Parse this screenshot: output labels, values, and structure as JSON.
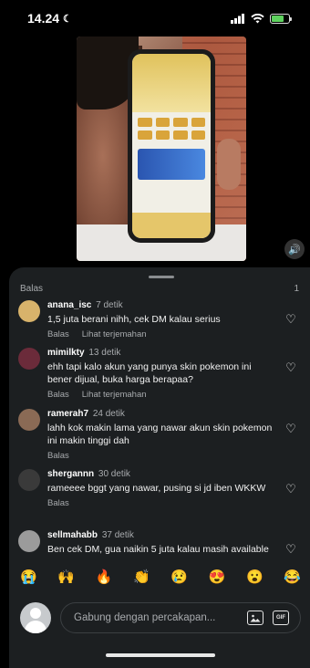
{
  "status": {
    "time": "14.24",
    "moon_icon": "moon-icon"
  },
  "video": {
    "volume_icon": "speaker-icon"
  },
  "sheet": {
    "top_reply_label": "Balas",
    "count": "1"
  },
  "comments": [
    {
      "user": "anana_isc",
      "time": "7 detik",
      "text": "1,5 juta berani nihh, cek DM kalau serius",
      "reply": "Balas",
      "translate": "Lihat terjemahan",
      "avatar_color": "#d8b36b"
    },
    {
      "user": "mimilkty",
      "time": "13 detik",
      "text": "ehh tapi kalo akun yang punya skin pokemon ini bener dijual, buka harga berapaa?",
      "reply": "Balas",
      "translate": "Lihat terjemahan",
      "avatar_color": "#6b2b3a"
    },
    {
      "user": "ramerah7",
      "time": "24 detik",
      "text": "lahh kok makin lama yang nawar akun skin pokemon ini makin tinggi dah",
      "reply": "Balas",
      "translate": "",
      "avatar_color": "#8a6a55"
    },
    {
      "user": "shergannn",
      "time": "30 detik",
      "text": "rameeee bggt yang nawar, pusing si jd iben WKKW",
      "reply": "Balas",
      "translate": "",
      "avatar_color": "#3a3a3a"
    },
    {
      "user": "sellmahabb",
      "time": "37 detik",
      "text": "Ben cek DM, gua naikin 5 juta kalau masih available",
      "reply": "",
      "translate": "",
      "avatar_color": "#9b9b9b"
    }
  ],
  "emojis": [
    "😭",
    "🙌",
    "🔥",
    "👏",
    "😢",
    "😍",
    "😮",
    "😂"
  ],
  "composer": {
    "placeholder": "Gabung dengan percakapan...",
    "image_icon": "image-icon",
    "gif_label": "GIF"
  },
  "colors": {
    "sheet_bg": "#1c1f21",
    "muted": "#a8abae",
    "battery": "#5ed15e"
  }
}
